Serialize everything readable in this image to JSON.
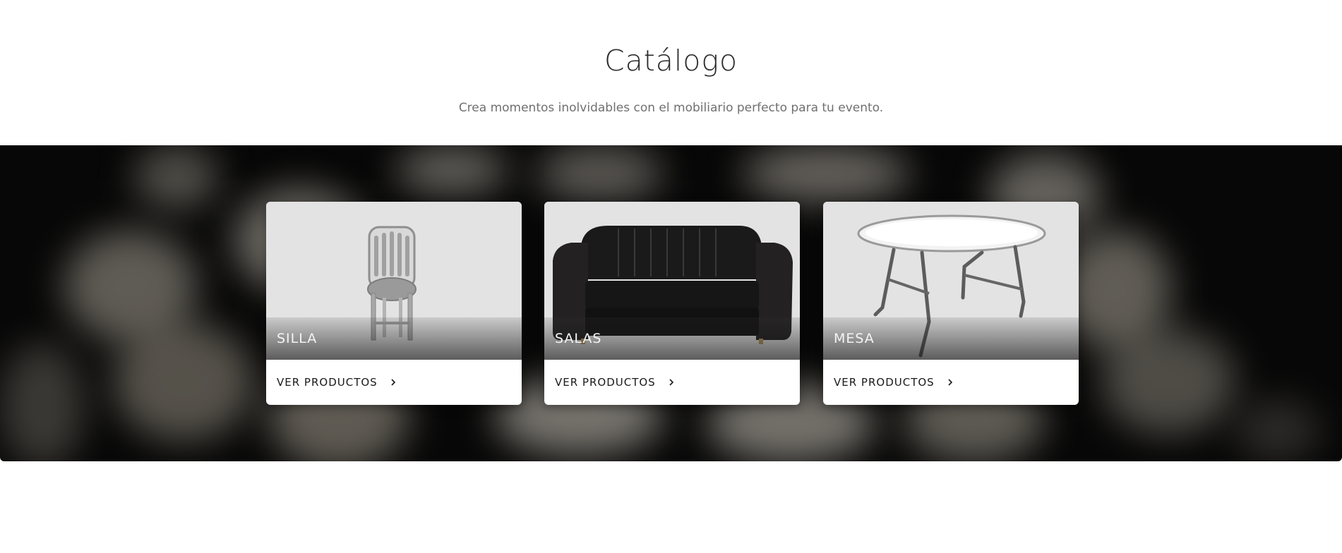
{
  "header": {
    "title": "Catálogo",
    "subtitle": "Crea momentos inolvidables con el mobiliario perfecto para tu evento."
  },
  "catalog": {
    "cards": [
      {
        "name": "SILLA",
        "link_label": "VER PRODUCTOS",
        "image": "chair-image"
      },
      {
        "name": "SALAS",
        "link_label": "VER PRODUCTOS",
        "image": "sofa-image"
      },
      {
        "name": "MESA",
        "link_label": "VER PRODUCTOS",
        "image": "table-image"
      }
    ]
  },
  "icons": {
    "link_arrow": "chevron-right-icon"
  },
  "colors": {
    "banner_background": "#070707",
    "card_image_background": "#e3e3e3",
    "title_text": "#2b2b2b",
    "subtitle_text": "#707070"
  }
}
